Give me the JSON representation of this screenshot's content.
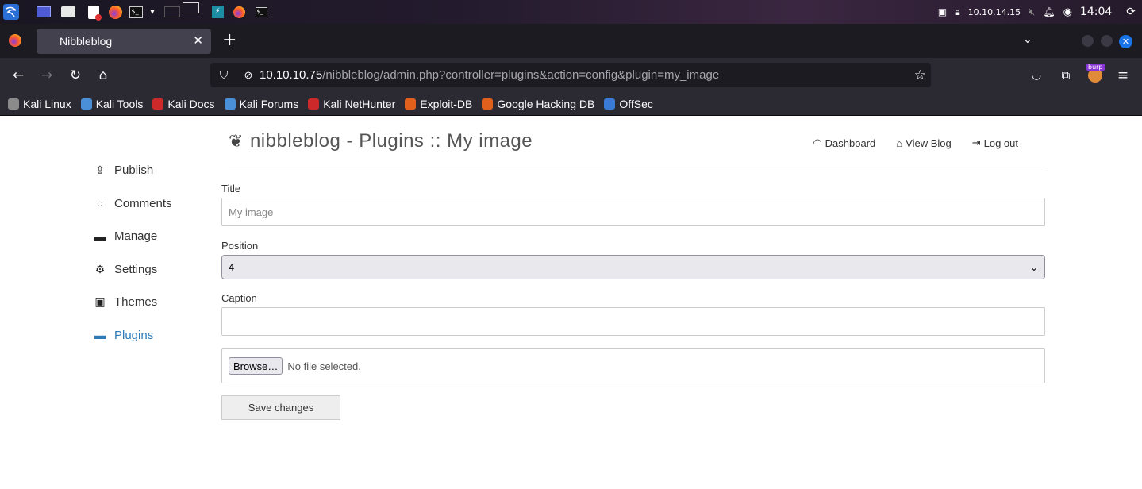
{
  "taskbar": {
    "ip": "10.10.14.15",
    "clock": "14:04"
  },
  "browser": {
    "tab_title": "Nibbleblog",
    "url_host": "10.10.10.75",
    "url_path": "/nibbleblog/admin.php?controller=plugins&action=config&plugin=my_image",
    "burp_badge": "burp"
  },
  "bookmarks": [
    {
      "label": "Kali Linux",
      "color": "#4a90d9"
    },
    {
      "label": "Kali Tools",
      "color": "#4a90d9"
    },
    {
      "label": "Kali Docs",
      "color": "#cc2a2a"
    },
    {
      "label": "Kali Forums",
      "color": "#4a90d9"
    },
    {
      "label": "Kali NetHunter",
      "color": "#cc2a2a"
    },
    {
      "label": "Exploit-DB",
      "color": "#e0601c"
    },
    {
      "label": "Google Hacking DB",
      "color": "#e0601c"
    },
    {
      "label": "OffSec",
      "color": "#3a7bd5"
    }
  ],
  "sidebar": {
    "items": [
      {
        "label": "Publish",
        "icon": "publish-icon"
      },
      {
        "label": "Comments",
        "icon": "comment-icon"
      },
      {
        "label": "Manage",
        "icon": "folder-icon"
      },
      {
        "label": "Settings",
        "icon": "gear-icon"
      },
      {
        "label": "Themes",
        "icon": "image-icon"
      },
      {
        "label": "Plugins",
        "icon": "folder-icon"
      }
    ],
    "active_color": "#2b7bb9"
  },
  "header": {
    "title": "nibbleblog - Plugins :: My image",
    "links": {
      "dashboard": "Dashboard",
      "view_blog": "View Blog",
      "logout": "Log out"
    }
  },
  "form": {
    "title_label": "Title",
    "title_placeholder": "My image",
    "position_label": "Position",
    "position_value": "4",
    "caption_label": "Caption",
    "browse_label": "Browse…",
    "no_file": "No file selected.",
    "save_label": "Save changes"
  }
}
